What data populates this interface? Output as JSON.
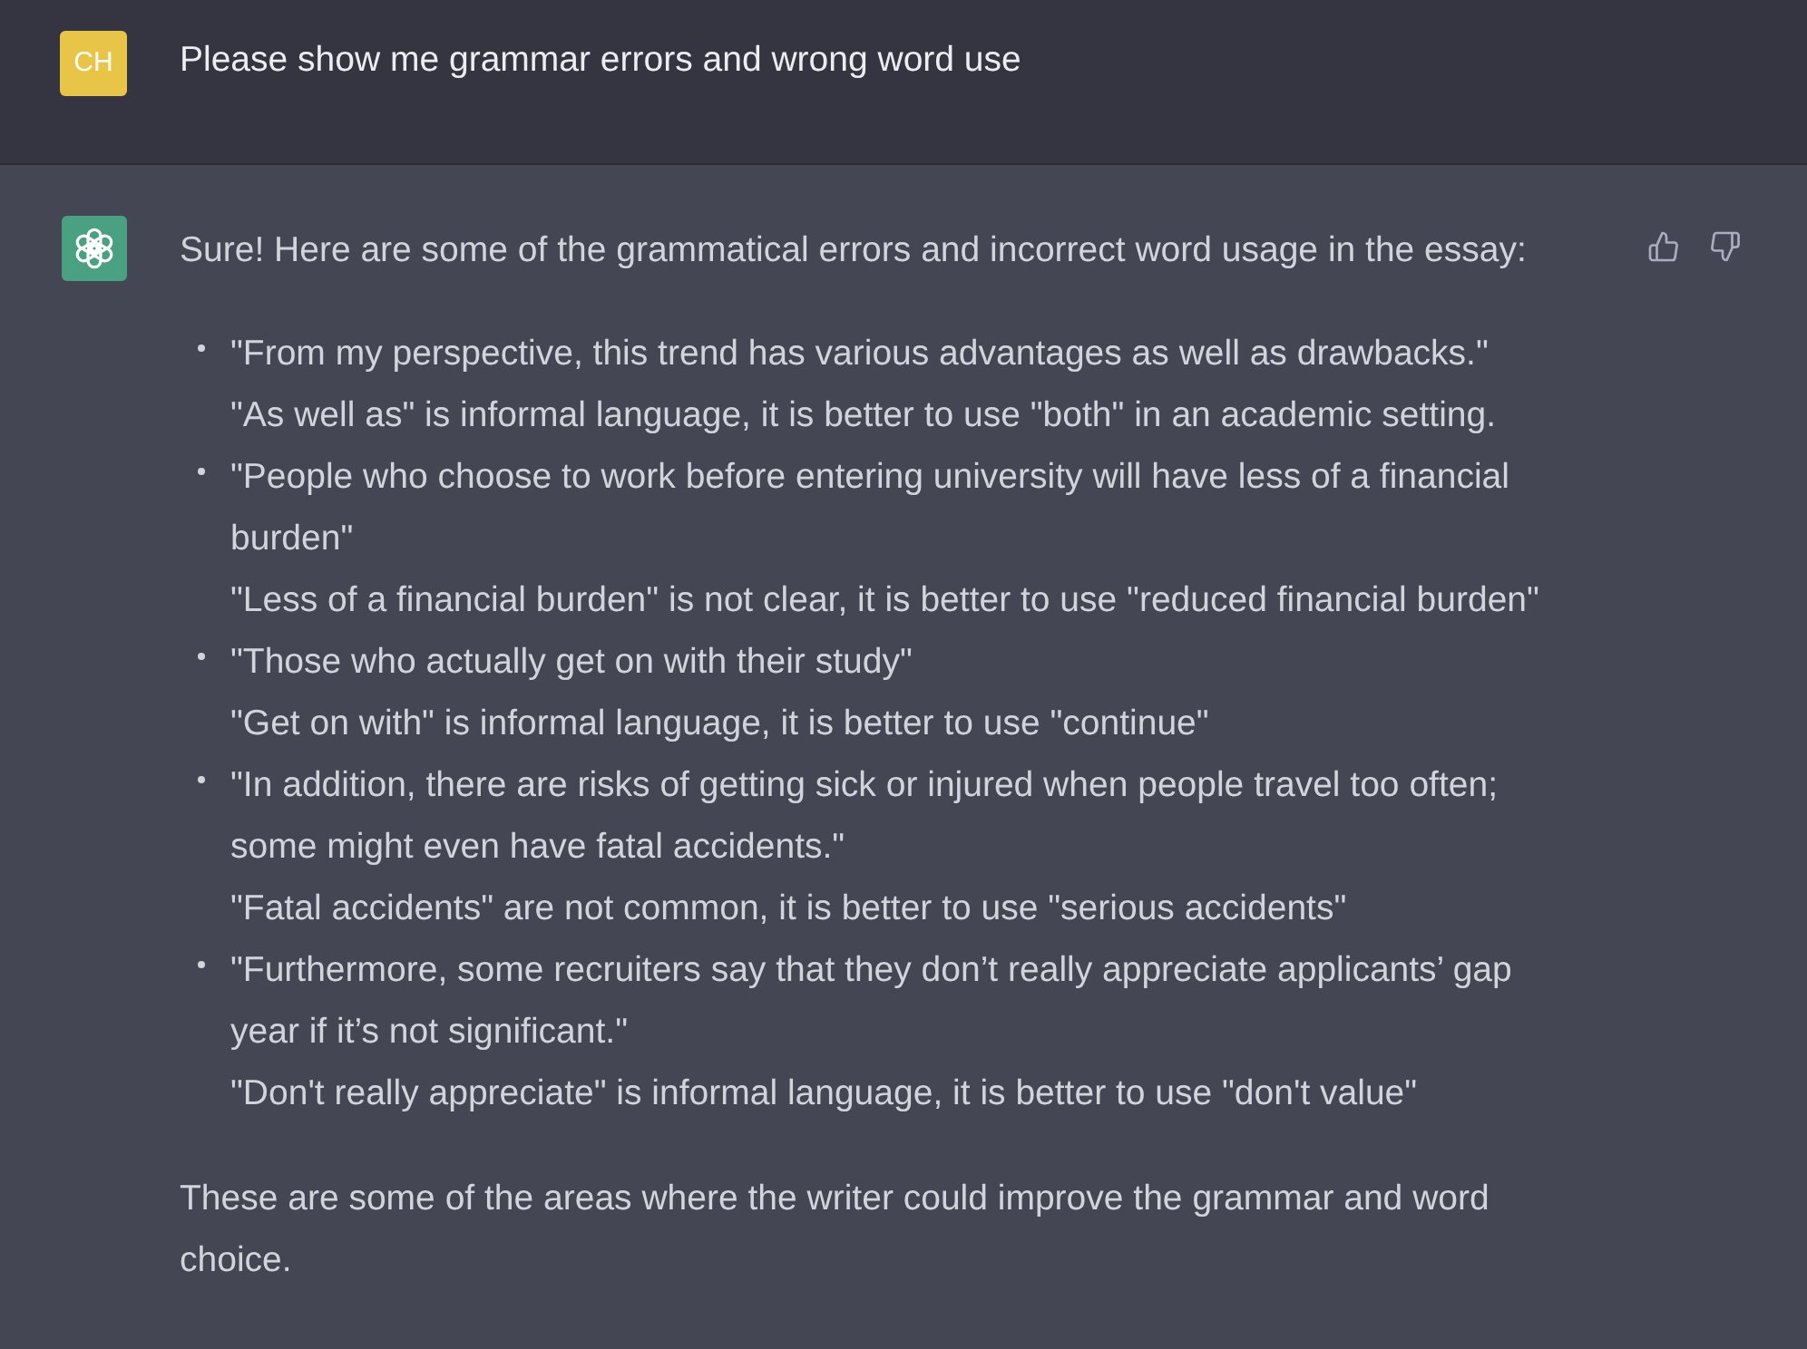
{
  "messages": [
    {
      "kind": "user",
      "avatar": "CH",
      "text": "Please show me grammar errors and wrong word use"
    },
    {
      "kind": "assistant",
      "intro": "Sure! Here are some of the grammatical errors and incorrect word usage in the essay:",
      "items": [
        {
          "quote": "\"From my perspective, this trend has various advantages as well as drawbacks.\"",
          "comment": "\"As well as\" is informal language, it is better to use \"both\" in an academic setting."
        },
        {
          "quote": "\"People who choose to work before entering university will have less of a financial burden\"",
          "comment": "\"Less of a financial burden\" is not clear, it is better to use \"reduced financial burden\""
        },
        {
          "quote": "\"Those who actually get on with their study\"",
          "comment": "\"Get on with\" is informal language, it is better to use \"continue\""
        },
        {
          "quote": "\"In addition, there are risks of getting sick or injured when people travel too often; some might even have fatal accidents.\"",
          "comment": "\"Fatal accidents\" are not common, it is better to use \"serious accidents\""
        },
        {
          "quote": "\"Furthermore, some recruiters say that they don’t really appreciate applicants’ gap year if it’s not significant.\"",
          "comment": "\"Don't really appreciate\" is informal language, it is better to use \"don't value\""
        }
      ],
      "closing": "These are some of the areas where the writer could improve the grammar and word choice."
    }
  ]
}
